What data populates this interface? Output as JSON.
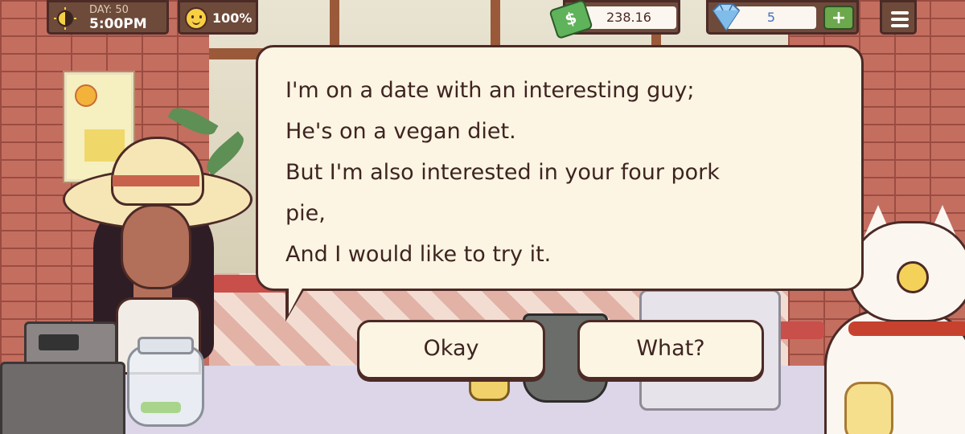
{
  "hud": {
    "day_label": "DAY: 50",
    "time": "5:00PM",
    "mood": "100%",
    "cash": "238.16",
    "gems": "5",
    "add_gems_label": "+"
  },
  "dialog": {
    "lines": [
      "I'm on a date with an interesting guy;",
      "He's on a vegan diet.",
      "But I'm also interested in your four pork",
      "pie,",
      "And I would like to try it."
    ]
  },
  "choices": {
    "okay": "Okay",
    "what": "What?"
  },
  "icons": {
    "day": "sun-moon-icon",
    "mood": "smiley-face-icon",
    "cash": "dollar-bill-icon",
    "gems": "diamond-icon",
    "menu": "hamburger-menu-icon"
  },
  "colors": {
    "hud_bg": "#6d4a3a",
    "bubble_bg": "#fcf5e3",
    "outline": "#4c2a26",
    "plus_green": "#6ca84c"
  }
}
